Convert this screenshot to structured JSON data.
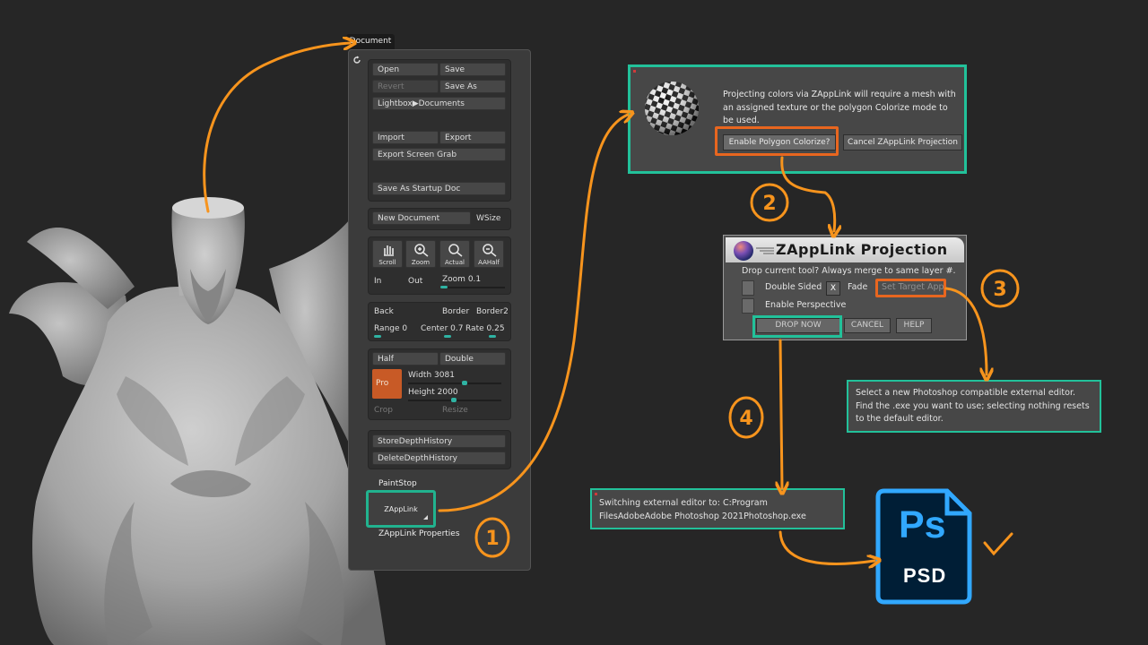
{
  "document_panel": {
    "tab_title": "Document",
    "open": "Open",
    "save": "Save",
    "revert": "Revert",
    "save_as": "Save As",
    "lightbox_documents": "Lightbox▶Documents",
    "import": "Import",
    "export": "Export",
    "export_screen_grab": "Export Screen Grab",
    "save_as_startup_doc": "Save As Startup Doc",
    "new_document": "New Document",
    "wsize": "WSize",
    "scroll": "Scroll",
    "zoom_icon": "Zoom",
    "actual": "Actual",
    "aahalf": "AAHalf",
    "in": "In",
    "out": "Out",
    "zoom_label": "Zoom",
    "zoom_value": "0.1",
    "back": "Back",
    "border": "Border",
    "border2": "Border2",
    "range_label": "Range",
    "range_value": "0",
    "center_label": "Center",
    "center_value": "0.7",
    "rate_label": "Rate",
    "rate_value": "0.25",
    "half": "Half",
    "double": "Double",
    "pro": "Pro",
    "width_label": "Width",
    "width_value": "3081",
    "height_label": "Height",
    "height_value": "2000",
    "crop": "Crop",
    "resize": "Resize",
    "store_depth_history": "StoreDepthHistory",
    "delete_depth_history": "DeleteDepthHistory",
    "paintstop": "PaintStop",
    "zapplink": "ZAppLink",
    "zapplink_properties": "ZAppLink Properties"
  },
  "notice_dialog": {
    "message": "Projecting colors via ZAppLink will require a mesh with an assigned texture or the polygon Colorize mode to be used.",
    "enable_polygon_colorize": "Enable Polygon Colorize?",
    "cancel_projection": "Cancel ZAppLink Projection"
  },
  "projection_dialog": {
    "title": "ZAppLink Projection",
    "subtitle": "Drop current tool? Always merge to same layer #.",
    "double_sided": "Double Sided",
    "x": "X",
    "fade": "Fade",
    "set_target_app": "Set Target App",
    "enable_perspective": "Enable Perspective",
    "drop_now": "DROP NOW",
    "cancel": "CANCEL",
    "help": "HELP"
  },
  "tooltip": {
    "text": "Select a new Photoshop compatible external editor. Find the .exe you want to use; selecting nothing resets to the default editor."
  },
  "status": {
    "text": "Switching external editor to: C:Program FilesAdobeAdobe Photoshop 2021Photoshop.exe"
  },
  "photoshop_icon": {
    "ps": "Ps",
    "psd": "PSD"
  },
  "steps": [
    "1",
    "2",
    "3",
    "4"
  ],
  "colors": {
    "annotation_orange": "#f7941d",
    "highlight_green": "#22c19a",
    "highlight_orange": "#e8661f",
    "slider_teal": "#2fb3a3",
    "ps_blue": "#31a8ff",
    "ps_dark": "#001e36"
  }
}
